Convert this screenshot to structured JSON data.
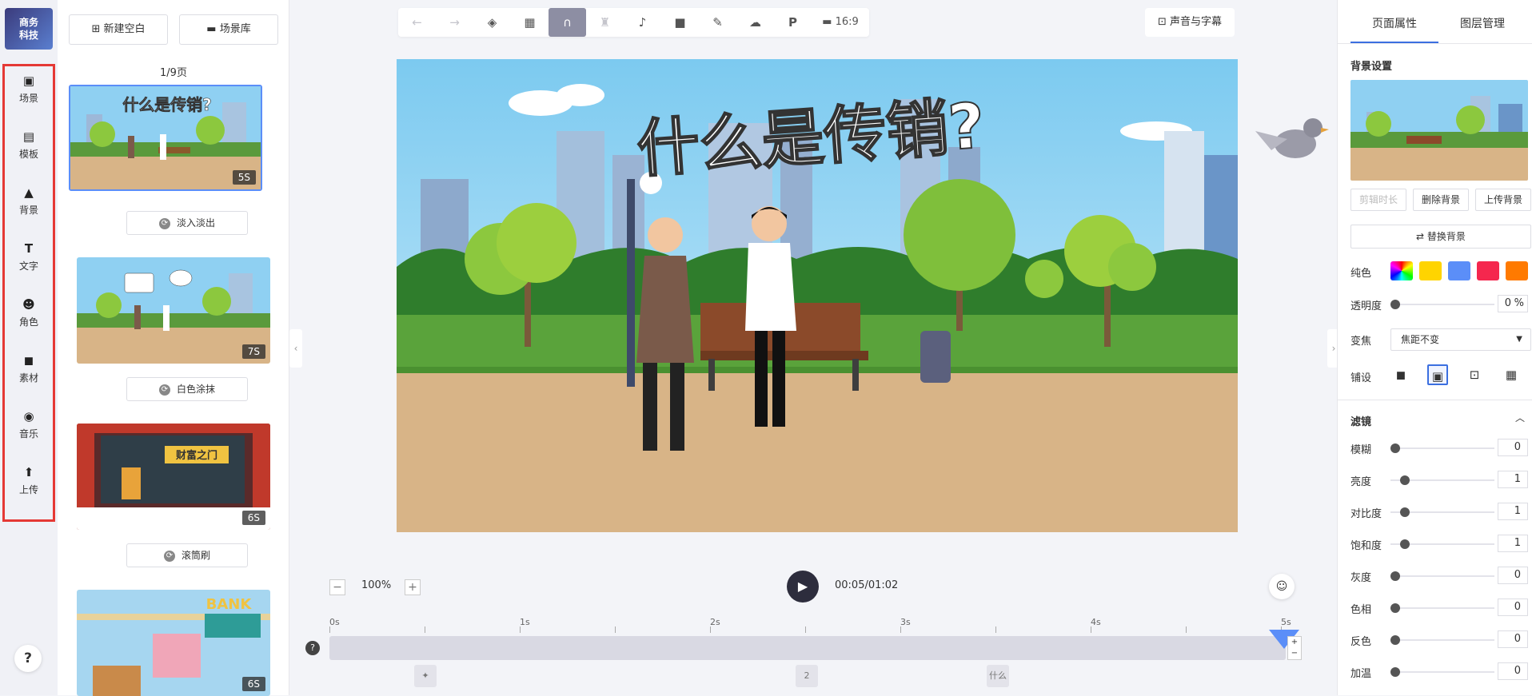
{
  "logo": {
    "line1": "商务",
    "line2": "科技"
  },
  "sidebar": {
    "items": [
      {
        "label": "场景",
        "icon": "scene-icon"
      },
      {
        "label": "模板",
        "icon": "template-icon"
      },
      {
        "label": "背景",
        "icon": "background-icon"
      },
      {
        "label": "文字",
        "icon": "text-icon"
      },
      {
        "label": "角色",
        "icon": "character-icon"
      },
      {
        "label": "素材",
        "icon": "material-icon"
      },
      {
        "label": "音乐",
        "icon": "music-icon"
      },
      {
        "label": "上传",
        "icon": "upload-icon"
      }
    ],
    "help": "?"
  },
  "scene_panel": {
    "new_blank": "新建空白",
    "scene_lib": "场景库",
    "page_count": "1/9页",
    "scenes": [
      {
        "title": "什么是传销?",
        "duration": "5S",
        "transition": "淡入淡出"
      },
      {
        "title": "",
        "duration": "7S",
        "transition": "白色涂抹"
      },
      {
        "title": "财富之门",
        "duration": "6S",
        "transition": "滚筒刷"
      },
      {
        "title": "BANK",
        "duration": "6S",
        "transition": ""
      }
    ]
  },
  "toolbar": {
    "ratio": "16:9",
    "sound_subtitle": "声音与字幕"
  },
  "canvas": {
    "title": "什么是传销?"
  },
  "playback": {
    "zoom": "100%",
    "time": "00:05/01:02",
    "ticks": [
      "0s",
      "1s",
      "2s",
      "3s",
      "4s",
      "5s"
    ],
    "help": "?",
    "track_label_2": "2",
    "track_label_3": "什么"
  },
  "right_panel": {
    "tab_page": "页面属性",
    "tab_layer": "图层管理",
    "bg_settings": "背景设置",
    "btn_trim": "剪辑时长",
    "btn_delete": "删除背景",
    "btn_upload": "上传背景",
    "btn_replace": "替换背景",
    "solid_label": "纯色",
    "opacity_label": "透明度",
    "opacity_value": "0",
    "opacity_unit": "%",
    "zoom_label": "变焦",
    "zoom_value": "焦距不变",
    "tile_label": "铺设",
    "filter_title": "滤镜",
    "filters": [
      {
        "label": "模糊",
        "value": "0"
      },
      {
        "label": "亮度",
        "value": "1"
      },
      {
        "label": "对比度",
        "value": "1"
      },
      {
        "label": "饱和度",
        "value": "1"
      },
      {
        "label": "灰度",
        "value": "0"
      },
      {
        "label": "色相",
        "value": "0"
      },
      {
        "label": "反色",
        "value": "0"
      },
      {
        "label": "加温",
        "value": "0"
      }
    ],
    "swatches": [
      "#ffd400",
      "#5b8ef8",
      "#f5274e",
      "#ff7a00"
    ]
  }
}
